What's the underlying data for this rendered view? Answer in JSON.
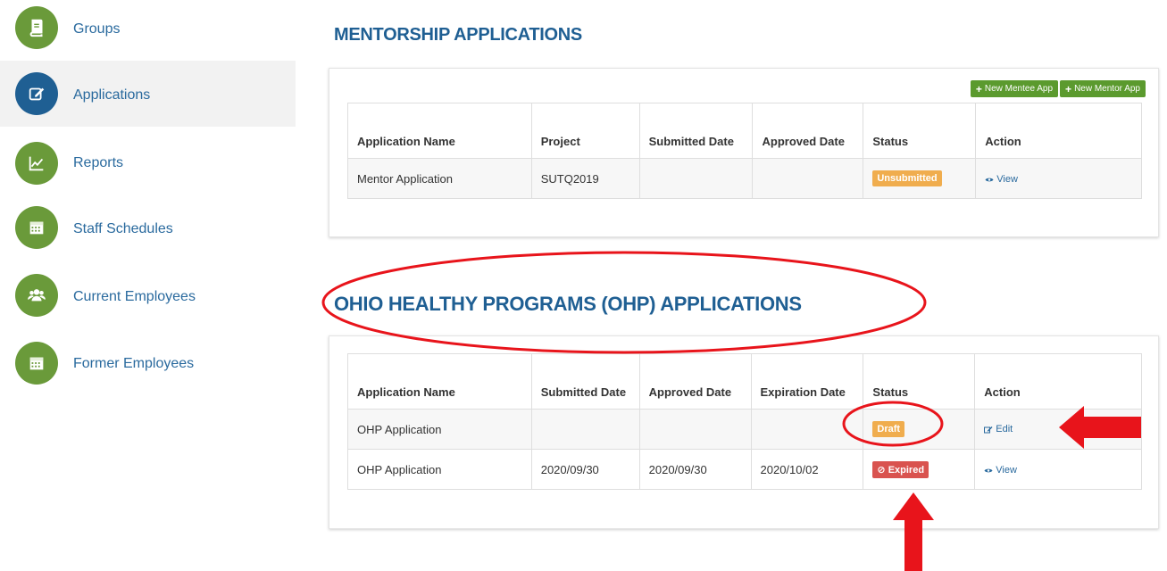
{
  "sidebar": {
    "items": [
      {
        "label": "Groups",
        "icon": "book-icon",
        "active": false
      },
      {
        "label": "Applications",
        "icon": "edit-icon",
        "active": true
      },
      {
        "label": "Reports",
        "icon": "chart-line-icon",
        "active": false
      },
      {
        "label": "Staff Schedules",
        "icon": "calendar-icon",
        "active": false
      },
      {
        "label": "Current Employees",
        "icon": "users-icon",
        "active": false
      },
      {
        "label": "Former Employees",
        "icon": "calendar-icon",
        "active": false
      }
    ]
  },
  "mentorship": {
    "title": "MENTORSHIP APPLICATIONS",
    "buttons": {
      "new_mentee": "New Mentee App",
      "new_mentor": "New Mentor App"
    },
    "columns": [
      "Application Name",
      "Project",
      "Submitted Date",
      "Approved Date",
      "Status",
      "Action"
    ],
    "rows": [
      {
        "name": "Mentor Application",
        "project": "SUTQ2019",
        "submitted": "",
        "approved": "",
        "status": "Unsubmitted",
        "action": "View"
      }
    ]
  },
  "ohp": {
    "title": "OHIO HEALTHY PROGRAMS (OHP) APPLICATIONS",
    "columns": [
      "Application Name",
      "Submitted Date",
      "Approved Date",
      "Expiration Date",
      "Status",
      "Action"
    ],
    "rows": [
      {
        "name": "OHP Application",
        "submitted": "",
        "approved": "",
        "expiration": "",
        "status": "Draft",
        "action": "Edit"
      },
      {
        "name": "OHP Application",
        "submitted": "2020/09/30",
        "approved": "2020/09/30",
        "expiration": "2020/10/02",
        "status": "Expired",
        "action": "View"
      }
    ]
  },
  "colors": {
    "nav_green": "#6a9a3a",
    "nav_active_blue": "#1f5f93",
    "badge_orange": "#f0ad4e",
    "badge_red": "#d9534f",
    "button_green": "#5b9a2e",
    "annotation_red": "#e8141b"
  }
}
